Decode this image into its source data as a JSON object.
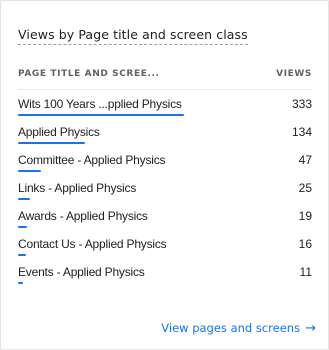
{
  "card": {
    "title": "Views by Page title and screen class",
    "columns": {
      "name": "PAGE TITLE AND SCREE...",
      "value": "VIEWS"
    },
    "rows": [
      {
        "name": "Wits 100 Years ...pplied Physics",
        "views": "333",
        "fraction": 1.0
      },
      {
        "name": "Applied Physics",
        "views": "134",
        "fraction": 0.402
      },
      {
        "name": "Committee - Applied Physics",
        "views": "47",
        "fraction": 0.141
      },
      {
        "name": "Links - Applied Physics",
        "views": "25",
        "fraction": 0.075
      },
      {
        "name": "Awards - Applied Physics",
        "views": "19",
        "fraction": 0.057
      },
      {
        "name": "Contact Us - Applied Physics",
        "views": "16",
        "fraction": 0.048
      },
      {
        "name": "Events - Applied Physics",
        "views": "11",
        "fraction": 0.033
      }
    ],
    "footer_link": "View pages and screens",
    "footer_arrow_icon": "arrow-right-icon",
    "accent_color": "#1a73e8"
  }
}
